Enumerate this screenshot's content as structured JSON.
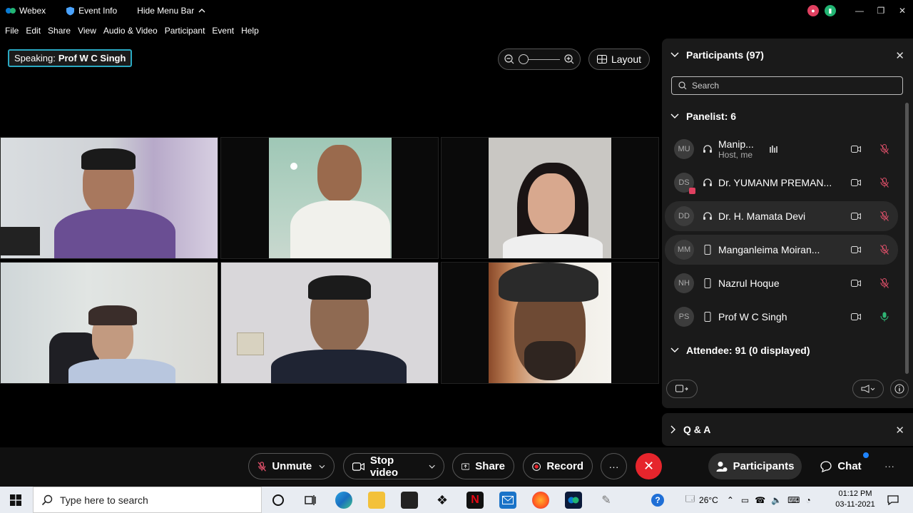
{
  "titlebar": {
    "app_name": "Webex",
    "event_info": "Event Info",
    "hide_menu_bar": "Hide Menu Bar"
  },
  "menu": [
    "File",
    "Edit",
    "Share",
    "View",
    "Audio & Video",
    "Participant",
    "Event",
    "Help"
  ],
  "speaking": {
    "label": "Speaking:",
    "name": "Prof W C Singh"
  },
  "toolbar": {
    "layout_label": "Layout",
    "zoom_level": 0
  },
  "panel": {
    "title": "Participants (97)",
    "search_placeholder": "Search",
    "panelist_header": "Panelist: 6",
    "attendee_header": "Attendee: 91 (0 displayed)",
    "panelists": [
      {
        "initials": "MU",
        "name": "Manip...",
        "sub": "Host, me",
        "device": "headset-icon",
        "mic": "muted",
        "speaking": true
      },
      {
        "initials": "DS",
        "name": "Dr. YUMANM PREMAN...",
        "sub": "",
        "device": "headset-icon",
        "mic": "muted",
        "speaking": false
      },
      {
        "initials": "DD",
        "name": "Dr. H. Mamata Devi",
        "sub": "",
        "device": "headset-icon",
        "mic": "muted",
        "speaking": false
      },
      {
        "initials": "MM",
        "name": "Manganleima Moiran...",
        "sub": "",
        "device": "mobile-icon",
        "mic": "muted",
        "speaking": false
      },
      {
        "initials": "NH",
        "name": "Nazrul Hoque",
        "sub": "",
        "device": "mobile-icon",
        "mic": "muted",
        "speaking": false
      },
      {
        "initials": "PS",
        "name": "Prof W C Singh",
        "sub": "",
        "device": "mobile-icon",
        "mic": "active",
        "speaking": false
      }
    ]
  },
  "qa": {
    "title": "Q & A"
  },
  "controls": {
    "unmute": "Unmute",
    "stop_video": "Stop video",
    "share": "Share",
    "record": "Record",
    "participants": "Participants",
    "chat": "Chat"
  },
  "taskbar": {
    "search_placeholder": "Type here to search",
    "temperature": "26°C",
    "time": "01:12 PM",
    "date": "03-11-2021"
  },
  "colors": {
    "accent": "#2aa9c2",
    "end_call": "#e6252c",
    "muted_mic": "#e0506a",
    "active_mic": "#2fb574",
    "chat_dot": "#1f84ff"
  }
}
